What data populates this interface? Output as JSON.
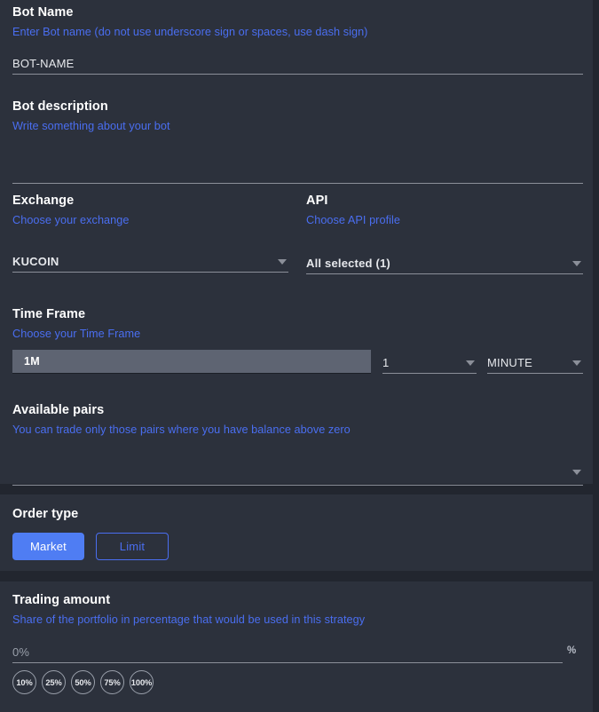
{
  "theme": {
    "page_bg": "#22262f",
    "panel_bg": "#2c313c",
    "accent_blue": "#4a6ef0",
    "button_blue": "#4f7df3",
    "text_primary": "#ffffff",
    "text_muted": "#9aa0ab",
    "underline": "#8b8f99",
    "timeframe_box_bg": "#5e6472"
  },
  "form": {
    "bot_name": {
      "title": "Bot Name",
      "hint": "Enter Bot name (do not use underscore sign or spaces, use dash sign)",
      "value": "BOT-NAME",
      "placeholder": ""
    },
    "bot_description": {
      "title": "Bot description",
      "hint": "Write something about your bot",
      "value": "",
      "placeholder": ""
    },
    "exchange": {
      "title": "Exchange",
      "hint": "Choose your exchange",
      "value": "KUCOIN",
      "caret": "chevron-down-icon"
    },
    "api": {
      "title": "API",
      "hint": "Choose API profile",
      "value": "All selected (1)",
      "caret": "chevron-down-icon"
    },
    "time_frame": {
      "title": "Time Frame",
      "hint": "Choose your Time Frame",
      "value": "1M",
      "amount": "1",
      "unit": "MINUTE"
    },
    "available_pairs": {
      "title": "Available pairs",
      "hint": "You can trade only those pairs where you have balance above zero",
      "value": "",
      "placeholder": ""
    },
    "order_type": {
      "title": "Order type",
      "options": [
        {
          "label": "Market",
          "selected": true
        },
        {
          "label": "Limit",
          "selected": false
        }
      ]
    },
    "trading_amount": {
      "title": "Trading amount",
      "hint": "Share of the portfolio in percentage that would be used in this strategy",
      "value": "0%",
      "suffix": "%",
      "quick_amounts": [
        "10%",
        "25%",
        "50%",
        "75%",
        "100%"
      ]
    }
  }
}
